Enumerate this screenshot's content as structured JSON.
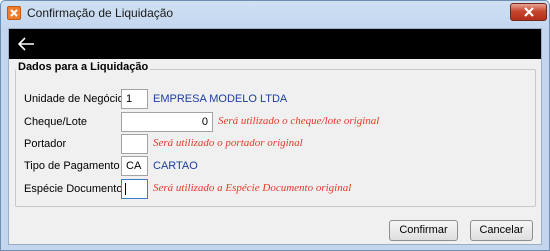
{
  "window": {
    "title": "Confirmação de Liquidação"
  },
  "group": {
    "title": "Dados para a Liquidação"
  },
  "fields": {
    "unidade": {
      "label": "Unidade de Negócio",
      "value": "1",
      "description": "EMPRESA MODELO LTDA"
    },
    "cheque": {
      "label": "Cheque/Lote",
      "value": "0",
      "hint": "Será utilizado o cheque/lote original"
    },
    "portador": {
      "label": "Portador",
      "value": "",
      "hint": "Será utilizado o portador original"
    },
    "tipo": {
      "label": "Tipo de Pagamento",
      "value": "CA",
      "description": "CARTAO"
    },
    "especie": {
      "label": "Espécie Documento",
      "value": "",
      "hint": "Será utilizado a Espécie Documento original"
    }
  },
  "buttons": {
    "confirm": "Confirmar",
    "cancel": "Cancelar"
  },
  "colors": {
    "hint": "#e53a2a",
    "description": "#1c3ea3",
    "header": "#000000"
  },
  "icons": {
    "app": "app-icon",
    "close": "close-icon",
    "back": "arrow-left-icon"
  }
}
